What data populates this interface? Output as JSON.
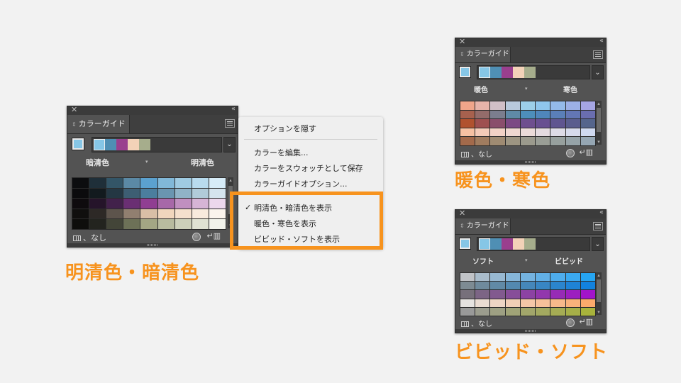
{
  "panel_tab_label": "カラーガイド",
  "none_label": "なし",
  "icons": {
    "close": "✕",
    "collapse": "‹‹",
    "dropdown": "⌄",
    "menu": "hamburger-icon",
    "triangle": "▾"
  },
  "panels": [
    {
      "id": "p1",
      "left_label": "暗清色",
      "right_label": "明清色",
      "group": [
        "#86c6e6",
        "#4f8fb4",
        "#9a3f8e",
        "#f3d2b8",
        "#a6ad8c"
      ],
      "rows": [
        [
          "#0c0d0f",
          "#1f2f39",
          "#335567",
          "#5b89a5",
          "#5ba1cf",
          "#81b8d8",
          "#9fcbe2",
          "#b8dbee",
          "#d7ecf7"
        ],
        [
          "#0b0b0d",
          "#121a1e",
          "#243743",
          "#3d5e73",
          "#4b7e9e",
          "#6a95b0",
          "#90b3c7",
          "#b1cbd9",
          "#d5e4ed"
        ],
        [
          "#0e0b0e",
          "#25142a",
          "#42214b",
          "#6a2f73",
          "#903e92",
          "#a768a8",
          "#c08fc0",
          "#d6b4d6",
          "#ecd8ec"
        ],
        [
          "#100f0e",
          "#2d2926",
          "#5d544c",
          "#917f70",
          "#d9bfa6",
          "#f1d6bd",
          "#f5e0cd",
          "#f8eadd",
          "#fbf4ed"
        ],
        [
          "#0e0e0c",
          "#23241f",
          "#434538",
          "#6d7157",
          "#a3a684",
          "#b8bb9f",
          "#cdd0ba",
          "#e0e2d3",
          "#f1f2ea"
        ]
      ]
    },
    {
      "id": "p2",
      "left_label": "暖色",
      "right_label": "寒色",
      "group": [
        "#86c6e6",
        "#4f8fb4",
        "#9a3f8e",
        "#f3d2b8",
        "#a6ad8c"
      ],
      "rows": [
        [
          "#f0a58a",
          "#e6b3a9",
          "#d1bfc7",
          "#b8c9dc",
          "#9ccfe9",
          "#8fc6ec",
          "#94baea",
          "#9cb0e6",
          "#a5a5e3"
        ],
        [
          "#a7614e",
          "#946c6a",
          "#7b7e8e",
          "#5f8aa7",
          "#4d8ebb",
          "#4f86bb",
          "#5a7fb9",
          "#6376b5",
          "#6a6eb0"
        ],
        [
          "#b0522f",
          "#9e5050",
          "#8a4e6c",
          "#7c4a84",
          "#6e4f8f",
          "#684f91",
          "#5f5590",
          "#5a5d8e",
          "#55658c"
        ],
        [
          "#f6c1a3",
          "#f4cbb8",
          "#f2d2c6",
          "#efd8d1",
          "#ebdbd9",
          "#e4dbe0",
          "#dddbe6",
          "#d6daeb",
          "#cfd9f0"
        ],
        [
          "#a36a4b",
          "#a07c5f",
          "#9f8b72",
          "#9d9582",
          "#9b9a8d",
          "#999d95",
          "#97a09e",
          "#96a3a8",
          "#95a6b3"
        ]
      ]
    },
    {
      "id": "p3",
      "left_label": "ソフト",
      "right_label": "ビビッド",
      "group": [
        "#86c6e6",
        "#4f8fb4",
        "#9a3f8e",
        "#f3d2b8",
        "#a6ad8c"
      ],
      "rows": [
        [
          "#c0c3c7",
          "#a9bccb",
          "#98b9d2",
          "#86b6d9",
          "#74b3e0",
          "#62b0e6",
          "#4eaded",
          "#3ba9f0",
          "#26a5f2"
        ],
        [
          "#7d8b93",
          "#6f8a9c",
          "#618aa6",
          "#5389b0",
          "#4587ba",
          "#3886c3",
          "#2b85cd",
          "#1e83d6",
          "#1282df"
        ],
        [
          "#77707b",
          "#7c6585",
          "#825a8f",
          "#874e99",
          "#8c42a3",
          "#9237ad",
          "#972bb6",
          "#9c1fc0",
          "#a214ca"
        ],
        [
          "#e6e3e0",
          "#eadcd2",
          "#eed5c4",
          "#f1ceb6",
          "#f4c7a8",
          "#f6c09a",
          "#f8b98b",
          "#fab27c",
          "#fcaa6c"
        ],
        [
          "#9a9a99",
          "#9c9d8e",
          "#9ea083",
          "#a0a377",
          "#a2a66b",
          "#a3a960",
          "#a5ac54",
          "#a6af48",
          "#a8b33c"
        ]
      ]
    }
  ],
  "popup": {
    "hide_options": "オプションを隠す",
    "edit_colors": "カラーを編集...",
    "save_as_swatch": "カラーをスウォッチとして保存",
    "guide_options": "カラーガイドオプション...",
    "show_tint_shade": "明清色・暗清色を表示",
    "show_warm_cool": "暖色・寒色を表示",
    "show_vivid_soft": "ビビッド・ソフトを表示",
    "checkmark": "✓"
  },
  "captions": {
    "tint_shade": "明清色・暗清色",
    "warm_cool": "暖色・寒色",
    "vivid_soft": "ビビッド・ソフト"
  },
  "highlight_color": "#f7931e"
}
